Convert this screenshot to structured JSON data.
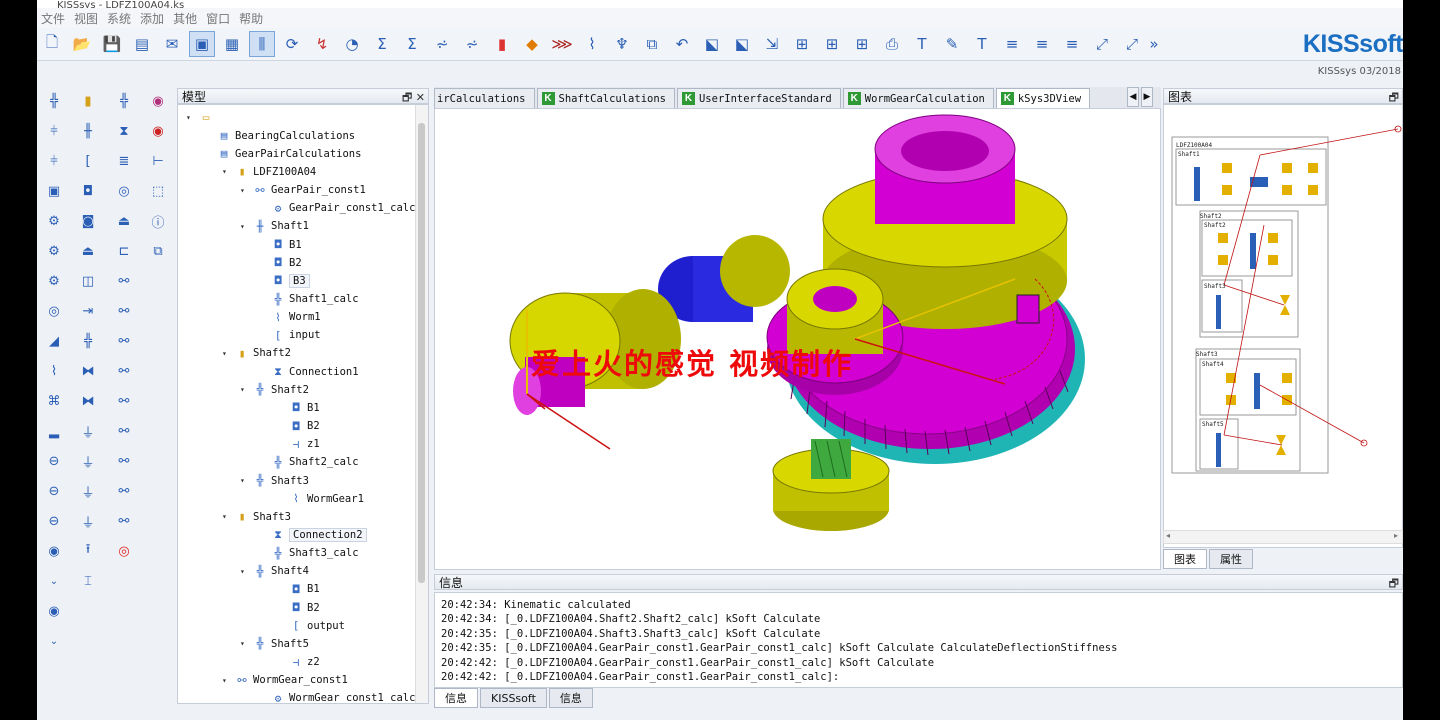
{
  "window": {
    "title": "KISSsys - LDFZ100A04.ks"
  },
  "menu": [
    "文件",
    "视图",
    "系统",
    "添加",
    "其他",
    "窗口",
    "帮助"
  ],
  "brand": {
    "name": "KISSsoft",
    "version": "KISSsys 03/2018"
  },
  "tree_panel": {
    "title": "模型",
    "nodes": [
      {
        "label": "",
        "icon": "folder-open-icon"
      },
      {
        "label": "BearingCalculations",
        "icon": "table-icon"
      },
      {
        "label": "GearPairCalculations",
        "icon": "table-icon"
      },
      {
        "label": "LDFZ100A04",
        "icon": "folder-icon"
      },
      {
        "label": "GearPair_const1",
        "icon": "constraint-icon"
      },
      {
        "label": "GearPair_const1_calc",
        "icon": "gears-calc-icon"
      },
      {
        "label": "Shaft1",
        "icon": "shaft-icon"
      },
      {
        "label": "B1",
        "icon": "bearing-icon"
      },
      {
        "label": "B2",
        "icon": "bearing-icon"
      },
      {
        "label": "B3",
        "icon": "bearing-icon"
      },
      {
        "label": "Shaft1_calc",
        "icon": "shaft-calc-icon"
      },
      {
        "label": "Worm1",
        "icon": "worm-icon"
      },
      {
        "label": "input",
        "icon": "coupling-icon"
      },
      {
        "label": "Shaft2",
        "icon": "folder-icon"
      },
      {
        "label": "Connection1",
        "icon": "connection-icon"
      },
      {
        "label": "Shaft2",
        "icon": "shaft-icon"
      },
      {
        "label": "B1",
        "icon": "bearing-icon"
      },
      {
        "label": "B2",
        "icon": "bearing-icon"
      },
      {
        "label": "z1",
        "icon": "gear-icon"
      },
      {
        "label": "Shaft2_calc",
        "icon": "shaft-calc-icon"
      },
      {
        "label": "Shaft3",
        "icon": "shaft-icon"
      },
      {
        "label": "WormGear1",
        "icon": "worm-gear-icon"
      },
      {
        "label": "Shaft3",
        "icon": "folder-icon"
      },
      {
        "label": "Connection2",
        "icon": "connection-icon"
      },
      {
        "label": "Shaft3_calc",
        "icon": "shaft-calc-icon"
      },
      {
        "label": "Shaft4",
        "icon": "shaft-icon"
      },
      {
        "label": "B1",
        "icon": "bearing-icon"
      },
      {
        "label": "B2",
        "icon": "bearing-icon"
      },
      {
        "label": "output",
        "icon": "coupling-icon"
      },
      {
        "label": "Shaft5",
        "icon": "shaft-icon"
      },
      {
        "label": "z2",
        "icon": "gear-icon"
      },
      {
        "label": "WormGear_const1",
        "icon": "constraint-icon"
      },
      {
        "label": "WormGear_const1_calc",
        "icon": "gears-calc-icon"
      }
    ]
  },
  "tabs": [
    {
      "label": "irCalculations",
      "badge": ""
    },
    {
      "label": "ShaftCalculations",
      "badge": "K"
    },
    {
      "label": "UserInterfaceStandard",
      "badge": "K"
    },
    {
      "label": "WormGearCalculation",
      "badge": "K"
    },
    {
      "label": "kSys3DView",
      "badge": "K"
    }
  ],
  "viewport": {
    "watermark": "爱上火的感觉 视频制作"
  },
  "info_panel": {
    "title": "信息",
    "lines": [
      "20:42:34: Kinematic calculated",
      "20:42:34: [_0.LDFZ100A04.Shaft2.Shaft2_calc] kSoft Calculate",
      "20:42:35: [_0.LDFZ100A04.Shaft3.Shaft3_calc] kSoft Calculate",
      "20:42:35: [_0.LDFZ100A04.GearPair_const1.GearPair_const1_calc] kSoft Calculate CalculateDeflectionStiffness",
      "20:42:42: [_0.LDFZ100A04.GearPair_const1.GearPair_const1_calc] kSoft Calculate",
      "20:42:42: [_0.LDFZ100A04.GearPair_const1.GearPair_const1_calc]:"
    ],
    "tabs": [
      "信息",
      "KISSsoft",
      "信息"
    ]
  },
  "diagram_panel": {
    "title": "图表",
    "labels": [
      "LDFZ100A04",
      "Shaft1",
      "Shaft2",
      "Shaft2",
      "Shaft3",
      "Shaft3",
      "Shaft4",
      "Shaft5"
    ],
    "tabs": [
      "图表",
      "属性"
    ]
  },
  "colors": {
    "gear_magenta": "#d200d2",
    "gear_yellow": "#c9c900",
    "teeth_cyan": "#1fb5b5",
    "accent_blue": "#1b6fc2"
  }
}
